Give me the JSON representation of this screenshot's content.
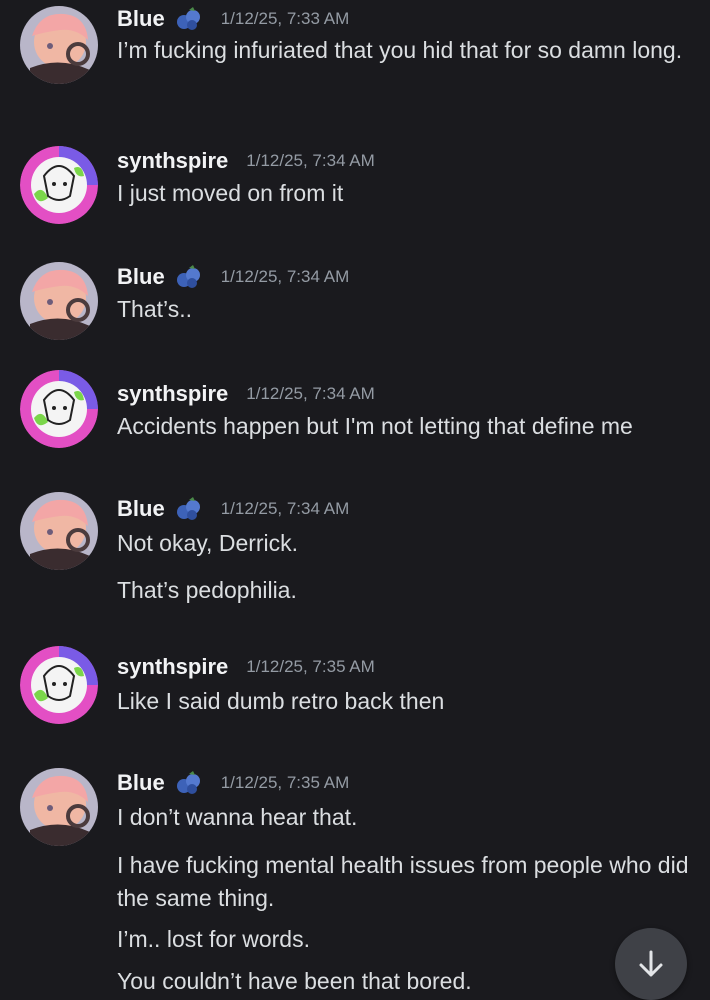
{
  "colors": {
    "background": "#1a1a1e",
    "username": "#f2f3f5",
    "timestamp": "#949ba4",
    "message_text": "#dbdee1",
    "scroll_button": "#3f4147"
  },
  "messages": [
    {
      "author": "Blue",
      "badge_icon": "blueberry-badge-icon",
      "timestamp": "1/12/25, 7:33 AM",
      "lines": [
        "I’m fucking infuriated that you hid that for so damn long."
      ]
    },
    {
      "author": "synthspire",
      "timestamp": "1/12/25, 7:34 AM",
      "lines": [
        "I just moved on from it"
      ]
    },
    {
      "author": "Blue",
      "badge_icon": "blueberry-badge-icon",
      "timestamp": "1/12/25, 7:34 AM",
      "lines": [
        "That’s.."
      ]
    },
    {
      "author": "synthspire",
      "timestamp": "1/12/25, 7:34 AM",
      "lines": [
        "Accidents happen but I'm not letting that define me"
      ]
    },
    {
      "author": "Blue",
      "badge_icon": "blueberry-badge-icon",
      "timestamp": "1/12/25, 7:34 AM",
      "lines": [
        "Not okay, Derrick.",
        "That’s pedophilia."
      ]
    },
    {
      "author": "synthspire",
      "timestamp": "1/12/25, 7:35 AM",
      "lines": [
        "Like I said dumb retro back then"
      ]
    },
    {
      "author": "Blue",
      "badge_icon": "blueberry-badge-icon",
      "timestamp": "1/12/25, 7:35 AM",
      "lines": [
        "I don’t wanna hear that.",
        "I have fucking mental health issues from people who did the same thing.",
        "I’m.. lost for words.",
        "You couldn’t have been that bored."
      ]
    }
  ],
  "scroll_button": {
    "icon": "arrow-down-icon"
  }
}
